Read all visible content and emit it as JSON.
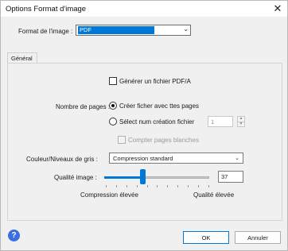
{
  "window": {
    "title": "Options Format d'image",
    "close_glyph": "✕"
  },
  "format": {
    "label": "Format de l'image :",
    "value": "PDF"
  },
  "tabs": [
    {
      "label": "Général",
      "active": true
    }
  ],
  "general": {
    "pdfa_checkbox": {
      "label": "Générer un fichier PDF/A",
      "checked": false
    },
    "page_count": {
      "label": "Nombre de pages :",
      "option_all": {
        "label": "Créer ficher avec ttes pages",
        "selected": true
      },
      "option_select": {
        "label": "Sélect num création fichier",
        "selected": false
      },
      "spin_value": "1",
      "count_blank": {
        "label": "Compter pages blanches",
        "checked": false,
        "enabled": false
      }
    },
    "color": {
      "label": "Couleur/Niveaux de gris :",
      "value": "Compression standard"
    },
    "quality": {
      "label": "Qualité image :",
      "value": "37",
      "slider_level": 0.37,
      "min_label": "Compression élevée",
      "max_label": "Qualité élevée"
    }
  },
  "buttons": {
    "ok": "OK",
    "cancel": "Annuler"
  },
  "icons": {
    "help": "question-mark-icon",
    "close": "close-icon",
    "dropdown": "chevron-down-icon"
  },
  "colors": {
    "accent": "#0078d7",
    "help": "#3c6ee0"
  }
}
